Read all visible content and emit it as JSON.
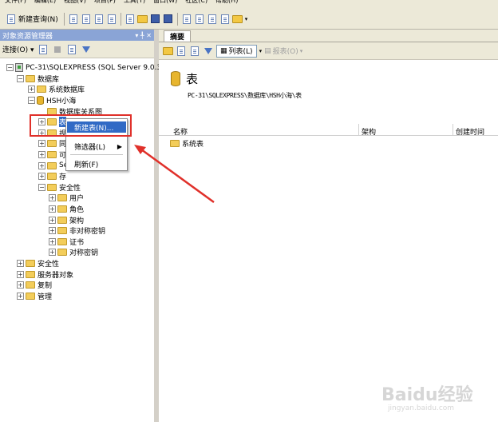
{
  "menubar": {
    "items": [
      "文件(F)",
      "编辑(E)",
      "视图(V)",
      "项目(P)",
      "工具(T)",
      "窗口(W)",
      "社区(C)",
      "帮助(H)"
    ]
  },
  "toolbar": {
    "new_query_label": "新建查询(N)"
  },
  "object_explorer": {
    "title": "对象资源管理器",
    "pin_symbol": "▾ ╀ ✕",
    "connect_label": "连接(O) ▾",
    "tree": {
      "server": "PC-31\\SQLEXPRESS (SQL Server 9.0.3042 -",
      "databases": "数据库",
      "system_databases": "系统数据库",
      "db_name": "HSH小海",
      "diagrams": "数据库关系图",
      "tables_partial": "表",
      "views_partial": "视",
      "synonyms_partial": "同",
      "programmability_partial": "可",
      "servicebroker_partial": "Se",
      "storage_partial": "存",
      "security": "安全性",
      "users": "用户",
      "roles": "角色",
      "schemas": "架构",
      "asym_keys": "非对称密钥",
      "certs": "证书",
      "sym_keys": "对称密钥",
      "top_security": "安全性",
      "server_objects": "服务器对象",
      "replication": "复制",
      "management": "管理"
    }
  },
  "context_menu": {
    "new_table": "新建表(N)...",
    "filter": "筛选器(L)",
    "refresh": "刷新(F)"
  },
  "summary": {
    "tab_label": "摘要",
    "list_button": "列表(L)",
    "report_button": "报表(O)",
    "heading": "表",
    "path": "PC-31\\SQLEXPRESS\\数据库\\HSH小海\\表",
    "columns": [
      "名称",
      "架构",
      "创建时间"
    ],
    "rows": [
      "系统表"
    ]
  },
  "watermark": {
    "brand": "Baidu经验",
    "url": "jingyan.baidu.com"
  },
  "colors": {
    "selection": "#316ac5",
    "highlight_box": "#e0302a",
    "arrow": "#e0302a",
    "panel_title": "#8aa4d6"
  }
}
